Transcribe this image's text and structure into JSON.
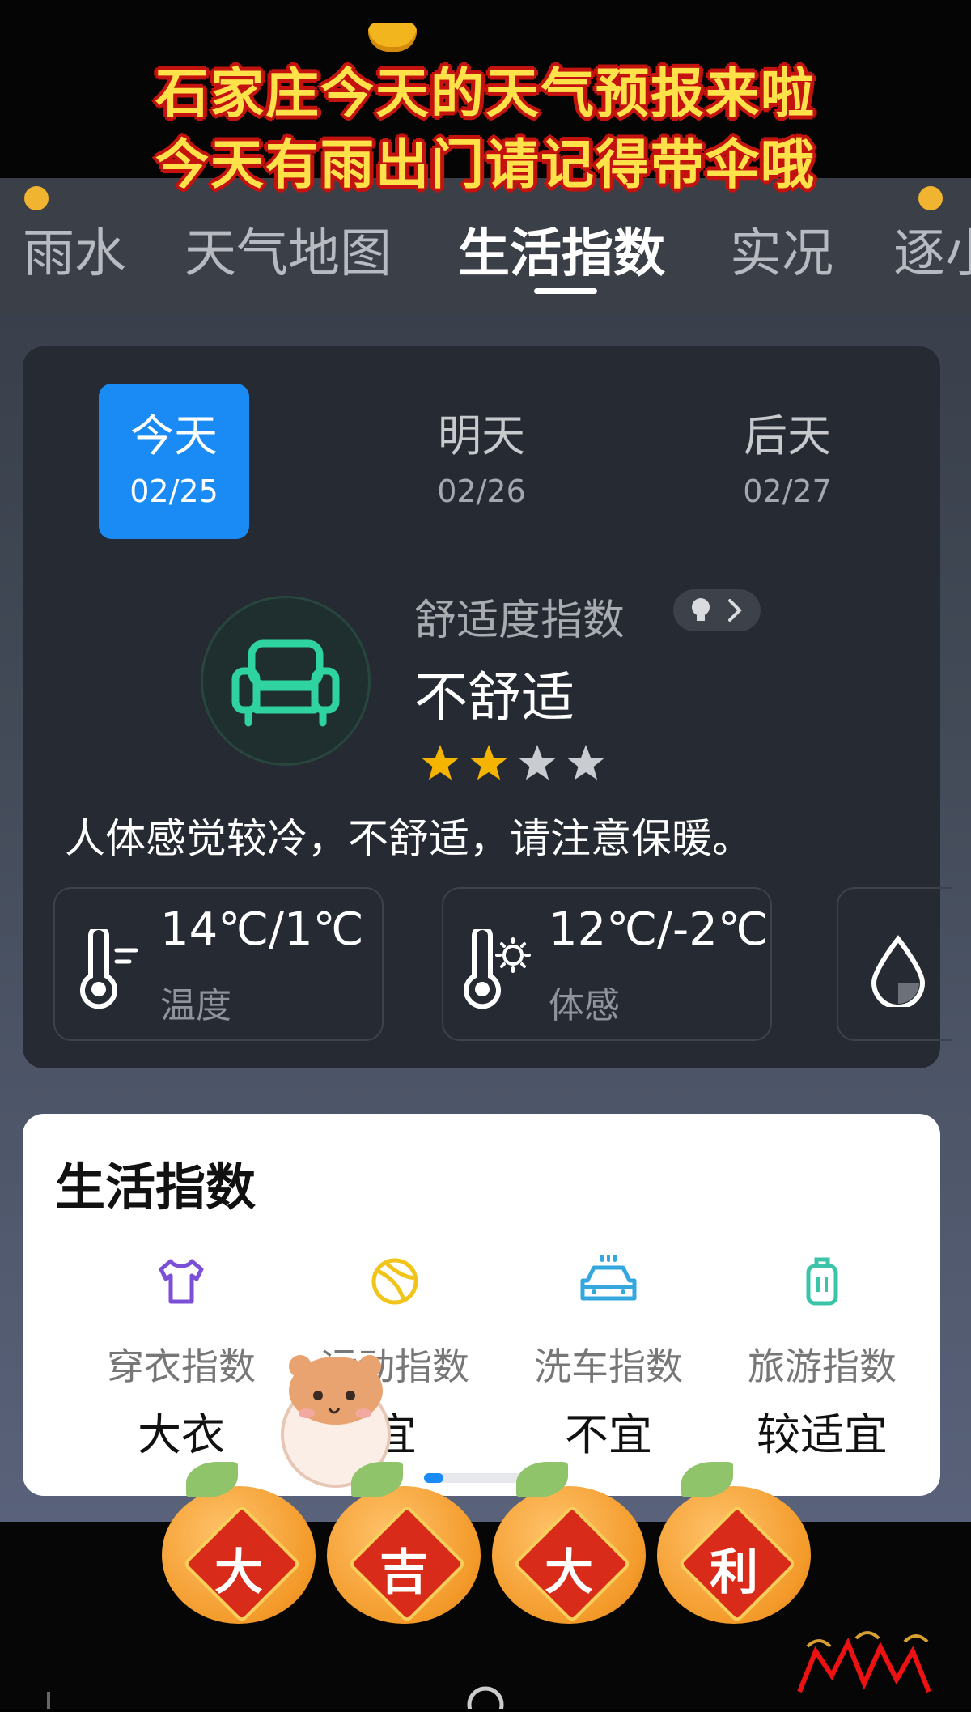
{
  "caption": {
    "line1": "石家庄今天的天气预报来啦",
    "line2": "今天有雨出门请记得带伞哦"
  },
  "tabs": [
    {
      "label": "雨水"
    },
    {
      "label": "天气地图"
    },
    {
      "label": "生活指数",
      "active": true
    },
    {
      "label": "实况"
    },
    {
      "label": "逐小"
    }
  ],
  "days": [
    {
      "name": "今天",
      "date": "02/25",
      "selected": true
    },
    {
      "name": "明天",
      "date": "02/26"
    },
    {
      "name": "后天",
      "date": "02/27"
    }
  ],
  "comfort": {
    "title": "舒适度指数",
    "value": "不舒适",
    "stars": {
      "filled": 2,
      "total": 4
    },
    "description": "人体感觉较冷，不舒适，请注意保暖。",
    "icon": "sofa-icon"
  },
  "metrics": [
    {
      "value": "14℃/1℃",
      "label": "温度",
      "icon": "thermometer-icon"
    },
    {
      "value": "12℃/-2℃",
      "label": "体感",
      "icon": "thermometer-sun-icon"
    },
    {
      "value": "",
      "label": "",
      "icon": "water-drop-icon"
    }
  ],
  "life": {
    "title": "生活指数",
    "items": [
      {
        "name": "穿衣指数",
        "value": "大衣",
        "icon": "shirt-icon",
        "color": "#7b4fd6"
      },
      {
        "name": "运动指数",
        "value": "宜",
        "icon": "ball-icon",
        "color": "#f0c419"
      },
      {
        "name": "洗车指数",
        "value": "不宜",
        "icon": "car-icon",
        "color": "#33a7de"
      },
      {
        "name": "旅游指数",
        "value": "较适宜",
        "icon": "luggage-icon",
        "color": "#3cc4a8"
      }
    ],
    "page_indicator": {
      "current": 1
    }
  },
  "stickers": {
    "oranges": [
      "大",
      "吉",
      "大",
      "利"
    ]
  },
  "colors": {
    "accent": "#1a8bf5",
    "star": "#f4b400",
    "comfort_icon": "#2fd3a0",
    "caption_text": "#ffe14a",
    "caption_outline": "#c4130f"
  }
}
